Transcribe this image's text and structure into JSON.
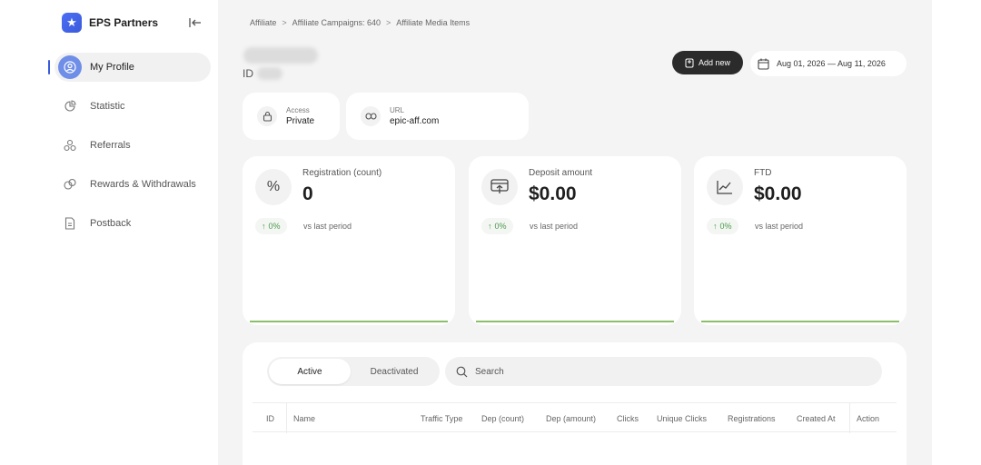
{
  "brand": {
    "name": "EPS Partners",
    "logo_icon": "star-icon"
  },
  "sidebar": {
    "items": [
      {
        "label": "My Profile",
        "icon": "user-circle-icon",
        "active": true
      },
      {
        "label": "Statistic",
        "icon": "pie-chart-icon",
        "active": false
      },
      {
        "label": "Referrals",
        "icon": "referrals-icon",
        "active": false
      },
      {
        "label": "Rewards & Withdrawals",
        "icon": "coins-icon",
        "active": false
      },
      {
        "label": "Postback",
        "icon": "document-icon",
        "active": false
      }
    ]
  },
  "breadcrumb": [
    "Affiliate",
    "Affiliate Campaigns: 640",
    "Affiliate Media Items"
  ],
  "header": {
    "id_label": "ID"
  },
  "toolbar": {
    "add_label": "Add new",
    "date_range": "Aug 01, 2026 — Aug 11, 2026"
  },
  "info": {
    "access": {
      "label": "Access",
      "value": "Private"
    },
    "url": {
      "label": "URL",
      "value": "epic-aff.com"
    }
  },
  "stats": [
    {
      "label": "Registration (count)",
      "value": "0",
      "trend": "0%",
      "vs": "vs last period",
      "icon": "percent-icon"
    },
    {
      "label": "Deposit amount",
      "value": "$0.00",
      "trend": "0%",
      "vs": "vs last period",
      "icon": "deposit-icon"
    },
    {
      "label": "FTD",
      "value": "$0.00",
      "trend": "0%",
      "vs": "vs last period",
      "icon": "line-chart-icon"
    }
  ],
  "tabs": {
    "active": "Active",
    "deactivated": "Deactivated"
  },
  "search": {
    "placeholder": "Search"
  },
  "table": {
    "columns": [
      "ID",
      "Name",
      "Traffic Type",
      "Dep (count)",
      "Dep (amount)",
      "Clicks",
      "Unique Clicks",
      "Registrations",
      "Created At",
      "Action"
    ]
  },
  "colors": {
    "accent": "#3b5bdb",
    "positive": "#4c9a4c",
    "sparkline": "#8bc06b",
    "button_dark": "#2b2b2b"
  }
}
